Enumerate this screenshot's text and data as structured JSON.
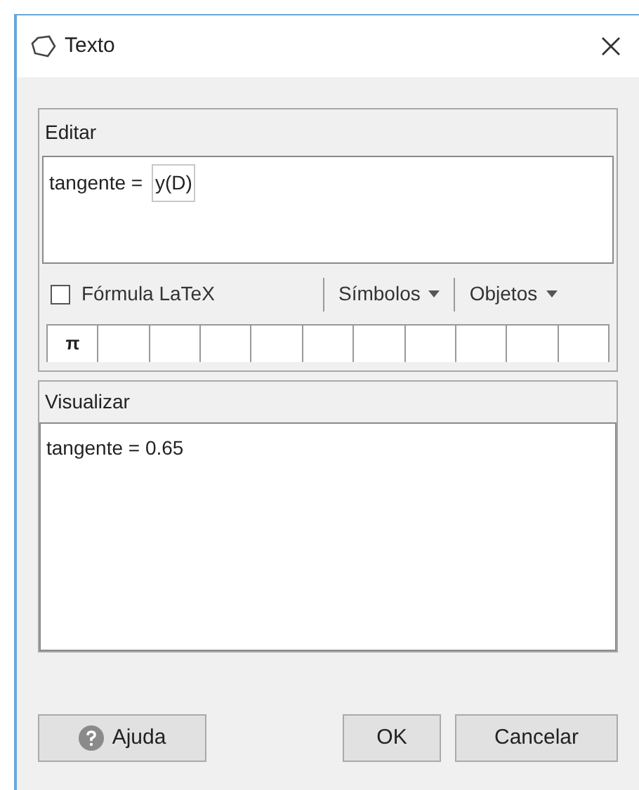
{
  "window": {
    "title": "Texto"
  },
  "edit_panel": {
    "title": "Editar",
    "text": "tangente = ",
    "object_field": "y(D)"
  },
  "toolbar": {
    "latex": {
      "label": "Fórmula LaTeX",
      "checked": false
    },
    "menus": [
      "Símbolos",
      "Objetos"
    ]
  },
  "symbol_palette": [
    "π"
  ],
  "preview_panel": {
    "title": "Visualizar",
    "text": "tangente = 0.65"
  },
  "buttons": {
    "help": "Ajuda",
    "ok": "OK",
    "cancel": "Cancelar"
  }
}
